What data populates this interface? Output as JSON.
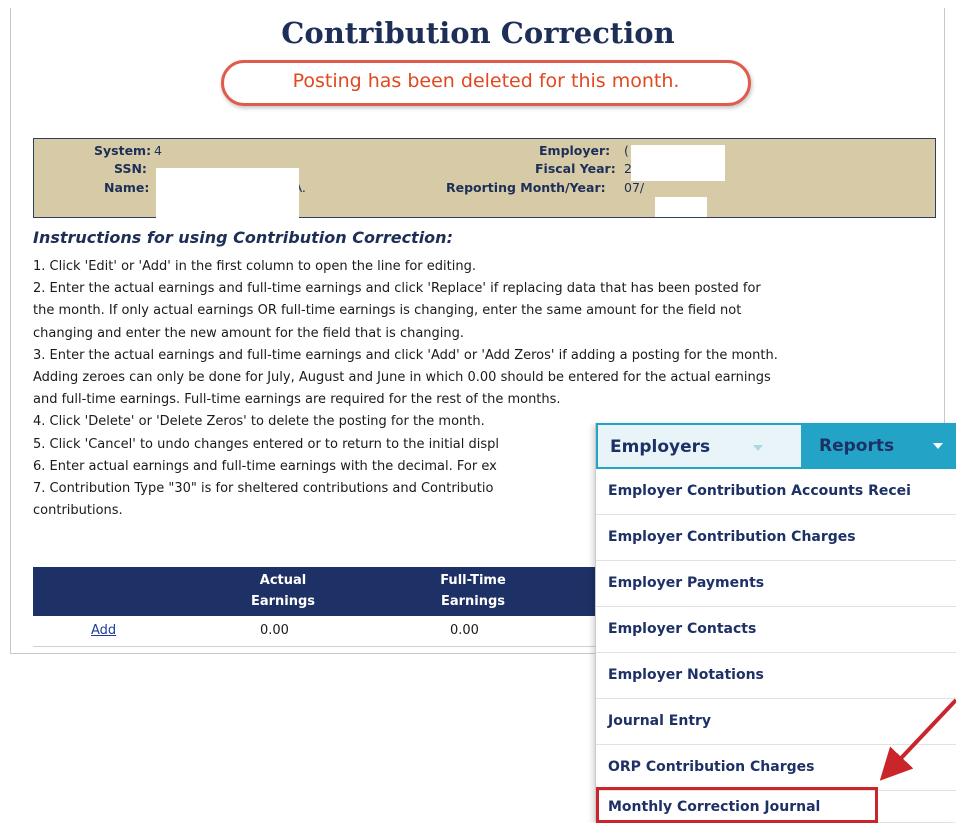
{
  "header": {
    "title": "Contribution Correction",
    "message": "Posting has been deleted for this month."
  },
  "info": {
    "system_label": "System:",
    "system_value": "4",
    "ssn_label": "SSN:",
    "name_label": "Name:",
    "name_value": "D A.",
    "employer_label": "Employer:",
    "employer_value": "(",
    "fiscal_year_label": "Fiscal Year:",
    "fiscal_year_value": "2",
    "reporting_label": "Reporting Month/Year:",
    "reporting_value": "07/"
  },
  "instructions": {
    "title": "Instructions for using Contribution Correction:",
    "lines": [
      "1. Click 'Edit' or 'Add' in the first column to open the line for editing.",
      "2. Enter the actual earnings and full-time earnings and click 'Replace' if replacing data that has been posted for",
      "the month. If only actual earnings OR full-time earnings is changing, enter the same amount for the field not",
      "changing and enter the new amount for the field that is changing.",
      "3. Enter the actual earnings and full-time earnings and click 'Add' or 'Add Zeros' if adding a posting for the month.",
      "Adding zeroes can only be done for July, August and June in which 0.00 should be entered for the actual earnings",
      "and full-time earnings. Full-time earnings are required for the rest of the months.",
      "4. Click 'Delete' or 'Delete Zeros' to delete the posting for the month.",
      "5. Click 'Cancel' to undo changes entered or to return to the initial displ",
      "6. Enter actual earnings and full-time earnings with the decimal. For ex",
      "7. Contribution Type \"30\" is for sheltered contributions and Contributio",
      "contributions."
    ]
  },
  "table": {
    "columns": [
      {
        "line1": "",
        "line2": ""
      },
      {
        "line1": "Actual",
        "line2": "Earnings"
      },
      {
        "line1": "Full-Time",
        "line2": "Earnings"
      }
    ],
    "rows": [
      {
        "action": "Add",
        "actual": "0.00",
        "fulltime": "0.00"
      }
    ]
  },
  "menu": {
    "tabs": [
      {
        "label": "Employers"
      },
      {
        "label": "Reports"
      }
    ],
    "items": [
      "Employer Contribution Accounts Recei",
      "Employer Contribution Charges",
      "Employer Payments",
      "Employer Contacts",
      "Employer Notations",
      "Journal Entry",
      "ORP Contribution Charges",
      "Monthly Correction Journal"
    ]
  },
  "colors": {
    "navy": "#1d3166",
    "accent_teal": "#23a4c6",
    "message_red": "#e0481f",
    "info_box_tan": "#d6cba6",
    "highlight_red": "#c9252b"
  }
}
